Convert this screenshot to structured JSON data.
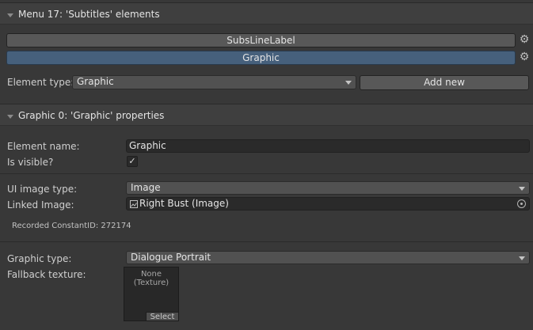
{
  "menu_section": {
    "title": "Menu 17: 'Subtitles' elements",
    "elements": [
      {
        "label": "SubsLineLabel",
        "selected": false
      },
      {
        "label": "Graphic",
        "selected": true
      }
    ],
    "element_type_label": "Element type:",
    "element_type_value": "Graphic",
    "add_new_label": "Add new"
  },
  "properties_section": {
    "title": "Graphic 0: 'Graphic' properties",
    "element_name_label": "Element name:",
    "element_name_value": "Graphic",
    "is_visible_label": "Is visible?",
    "is_visible_checked": true,
    "checkmark": "✓",
    "ui_image_type_label": "UI image type:",
    "ui_image_type_value": "Image",
    "linked_image_label": "Linked Image:",
    "linked_image_value": "Right Bust (Image)",
    "recorded_constant_id": "Recorded ConstantID: 272174",
    "graphic_type_label": "Graphic type:",
    "graphic_type_value": "Dialogue Portrait",
    "fallback_texture_label": "Fallback texture:",
    "texture_none_line1": "None",
    "texture_none_line2": "(Texture)",
    "texture_select_label": "Select"
  },
  "icons": {
    "gear": "⚙",
    "image_object": "image-icon"
  },
  "colors": {
    "background": "#383838",
    "header": "#3f3f3f",
    "selected_button": "#46607c",
    "button": "#585858"
  }
}
